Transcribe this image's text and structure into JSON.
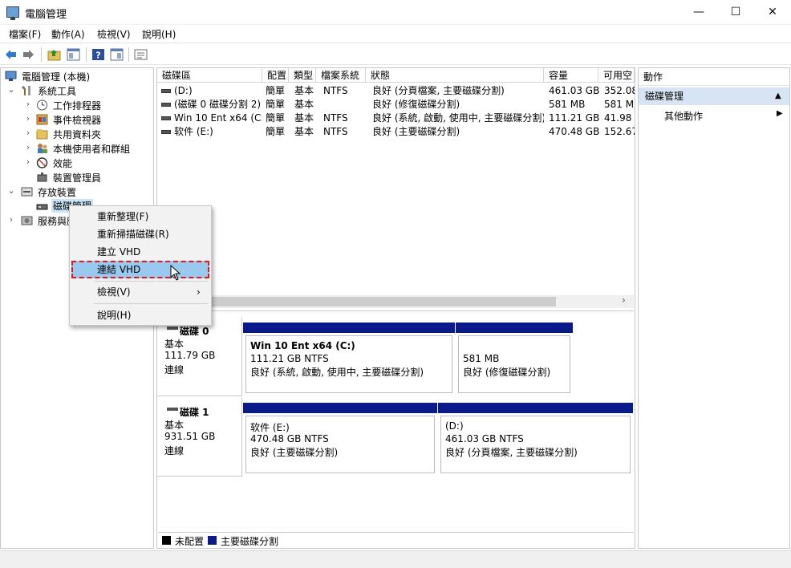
{
  "window": {
    "title": "電腦管理",
    "minimize_glyph": "—",
    "maximize_glyph": "☐",
    "close_glyph": "✕"
  },
  "menu": {
    "file": "檔案(F)",
    "action": "動作(A)",
    "view": "檢視(V)",
    "help": "說明(H)"
  },
  "toolbar": {
    "icons": [
      "back-arrow-icon",
      "forward-arrow-icon",
      "up-folder-icon",
      "show-hide-tree-icon",
      "help-icon",
      "console-icon",
      "properties-icon"
    ]
  },
  "tree": {
    "root": "電腦管理 (本機)",
    "system_tools": "系統工具",
    "task_scheduler": "工作排程器",
    "event_viewer": "事件檢視器",
    "shared_folders": "共用資料夾",
    "local_users": "本機使用者和群組",
    "performance": "效能",
    "device_manager": "裝置管理員",
    "storage": "存放裝置",
    "disk_management": "磁碟管理",
    "services": "服務與應用程式"
  },
  "volumes": {
    "headers": [
      "磁碟區",
      "配置",
      "類型",
      "檔案系統",
      "狀態",
      "容量",
      "可用空"
    ],
    "rows": [
      [
        "(D:)",
        "簡單",
        "基本",
        "NTFS",
        "良好 (分頁檔案, 主要磁碟分割)",
        "461.03 GB",
        "352.08"
      ],
      [
        "(磁碟 0 磁碟分割 2)",
        "簡單",
        "基本",
        "",
        "良好 (修復磁碟分割)",
        "581 MB",
        "581 M"
      ],
      [
        "Win 10 Ent x64 (C:)",
        "簡單",
        "基本",
        "NTFS",
        "良好 (系統, 啟動, 使用中, 主要磁碟分割)",
        "111.21 GB",
        "41.98 C"
      ],
      [
        "软件 (E:)",
        "簡單",
        "基本",
        "NTFS",
        "良好 (主要磁碟分割)",
        "470.48 GB",
        "152.67"
      ]
    ],
    "scroll_right_glyph": "›"
  },
  "disks": [
    {
      "name": "磁碟 0",
      "type": "基本",
      "size": "111.79 GB",
      "status": "連線",
      "partitions": [
        {
          "title": "Win 10 Ent x64  (C:)",
          "size": "111.21 GB NTFS",
          "status": "良好 (系統, 啟動, 使用中, 主要磁碟分割)"
        },
        {
          "title": "",
          "size": "581 MB",
          "status": "良好 (修復磁碟分割)"
        }
      ]
    },
    {
      "name": "磁碟 1",
      "type": "基本",
      "size": "931.51 GB",
      "status": "連線",
      "partitions": [
        {
          "title": "软件  (E:)",
          "size": "470.48 GB NTFS",
          "status": "良好 (主要磁碟分割)"
        },
        {
          "title": "(D:)",
          "size": "461.03 GB NTFS",
          "status": "良好 (分頁檔案, 主要磁碟分割)"
        }
      ]
    }
  ],
  "legend": {
    "unallocated": "未配置",
    "primary": "主要磁碟分割",
    "unallocated_color": "#000000",
    "primary_color": "#0a1a8a"
  },
  "actions": {
    "header": "動作",
    "section": "磁碟管理",
    "more": "其他動作",
    "collapse_glyph": "▲",
    "more_glyph": "▶"
  },
  "context_menu": {
    "refresh": "重新整理(F)",
    "rescan": "重新掃描磁碟(R)",
    "create_vhd": "建立 VHD",
    "attach_vhd": "連結 VHD",
    "view": "檢視(V)",
    "view_arrow": "›",
    "help": "說明(H)"
  }
}
